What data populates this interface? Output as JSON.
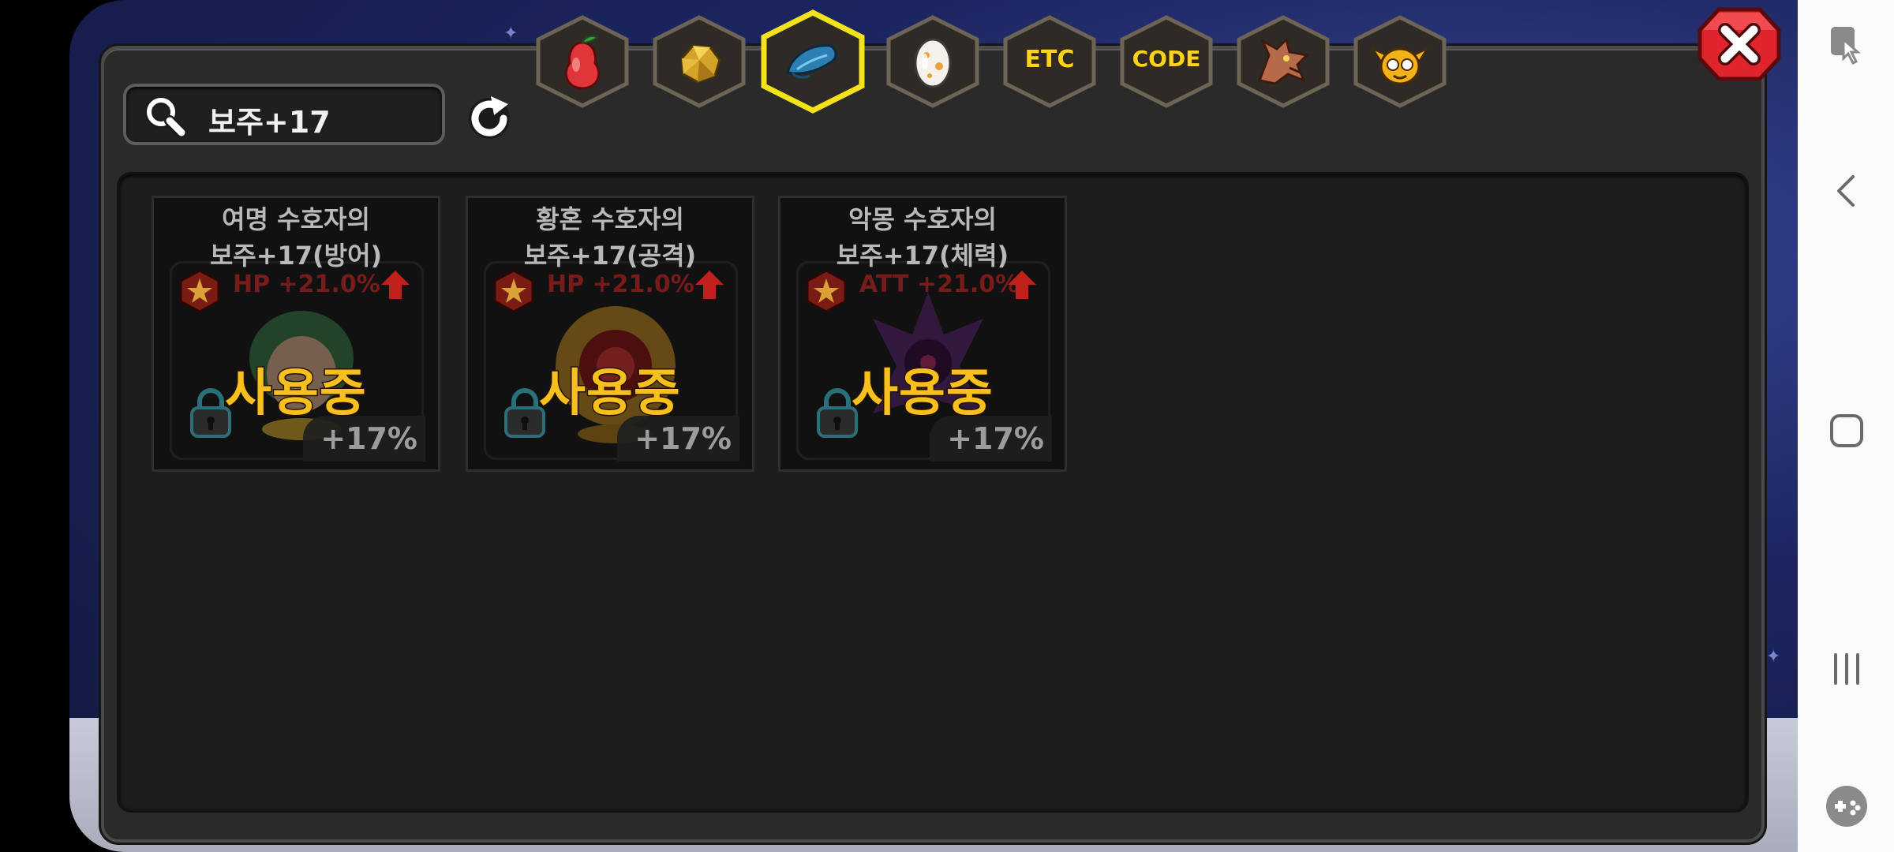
{
  "search": {
    "value": "보주+17"
  },
  "tabs": [
    {
      "name": "fruit",
      "icon": "pear-fruit-icon",
      "label": "",
      "selected": false
    },
    {
      "name": "ore",
      "icon": "gold-ore-icon",
      "label": "",
      "selected": false
    },
    {
      "name": "orb",
      "icon": "blue-feather-orb-icon",
      "label": "",
      "selected": true
    },
    {
      "name": "egg",
      "icon": "egg-icon",
      "label": "",
      "selected": false
    },
    {
      "name": "etc",
      "icon": "",
      "label": "ETC",
      "selected": false
    },
    {
      "name": "code",
      "icon": "",
      "label": "CODE",
      "selected": false
    },
    {
      "name": "dragon",
      "icon": "dragon-head-icon",
      "label": "",
      "selected": false
    },
    {
      "name": "mask",
      "icon": "winged-mask-icon",
      "label": "",
      "selected": false
    }
  ],
  "items": [
    {
      "name_line1": "여명 수호자의",
      "name_line2": "보주+17(방어)",
      "stat": "HP +21.0%",
      "status": "사용중",
      "percent": "+17%",
      "art": "green-haired-guardian",
      "art_color": "#3f7a4a"
    },
    {
      "name_line1": "황혼 수호자의",
      "name_line2": "보주+17(공격)",
      "stat": "HP +21.0%",
      "status": "사용중",
      "percent": "+17%",
      "art": "golden-sun-guardian",
      "art_color": "#b8882a"
    },
    {
      "name_line1": "악몽 수호자의",
      "name_line2": "보주+17(체력)",
      "stat": "ATT +21.0%",
      "status": "사용중",
      "percent": "+17%",
      "art": "dark-purple-guardian",
      "art_color": "#5a2d6e"
    }
  ],
  "colors": {
    "accent_yellow": "#f7c01e",
    "tab_selected_border": "#f4e21a",
    "close_red": "#e0242b",
    "stat_red": "#8b1d1d"
  },
  "system_nav": {
    "icons": [
      "game-tools-icon",
      "back-icon",
      "home-icon",
      "recents-icon",
      "game-pad-icon"
    ]
  }
}
